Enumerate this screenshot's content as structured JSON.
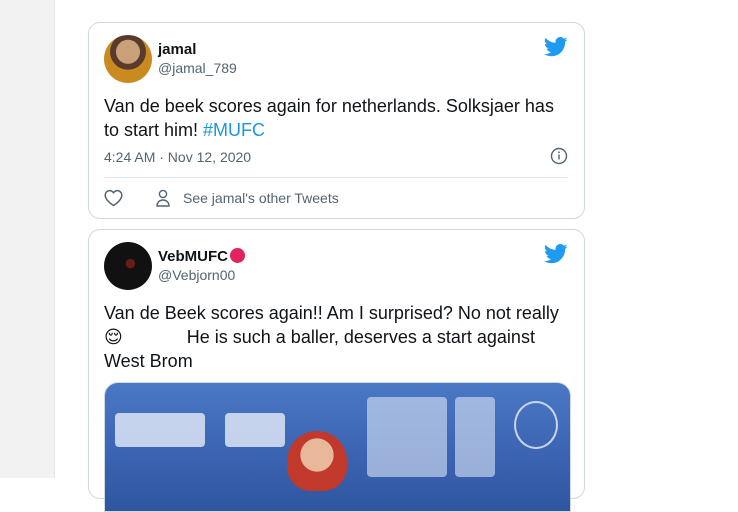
{
  "tweets": [
    {
      "display_name": "jamal",
      "handle": "@jamal_789",
      "text": "Van de beek scores again for netherlands. Solksjaer has to start him! ",
      "hashtag": "#MUFC",
      "timestamp": "4:24 AM · Nov 12, 2020",
      "other_tweets_label": "See jamal's other Tweets",
      "icons": [
        "twitter-bird-icon",
        "info-icon",
        "heart-icon",
        "person-icon"
      ]
    },
    {
      "display_name": "VebMUFC",
      "handle": "@Vebjorn00",
      "text_part1": "Van de Beek scores again!! Am I surprised? No not really",
      "emoji": "😌",
      "text_part2": "He is such a baller, deserves a start against West Brom",
      "icons": [
        "twitter-bird-icon",
        "red-circle-icon"
      ]
    }
  ],
  "colors": {
    "accent": "#1b95e0",
    "handle_gray": "#536471",
    "border": "#cfd9de",
    "red_dot": "#e0245e"
  }
}
